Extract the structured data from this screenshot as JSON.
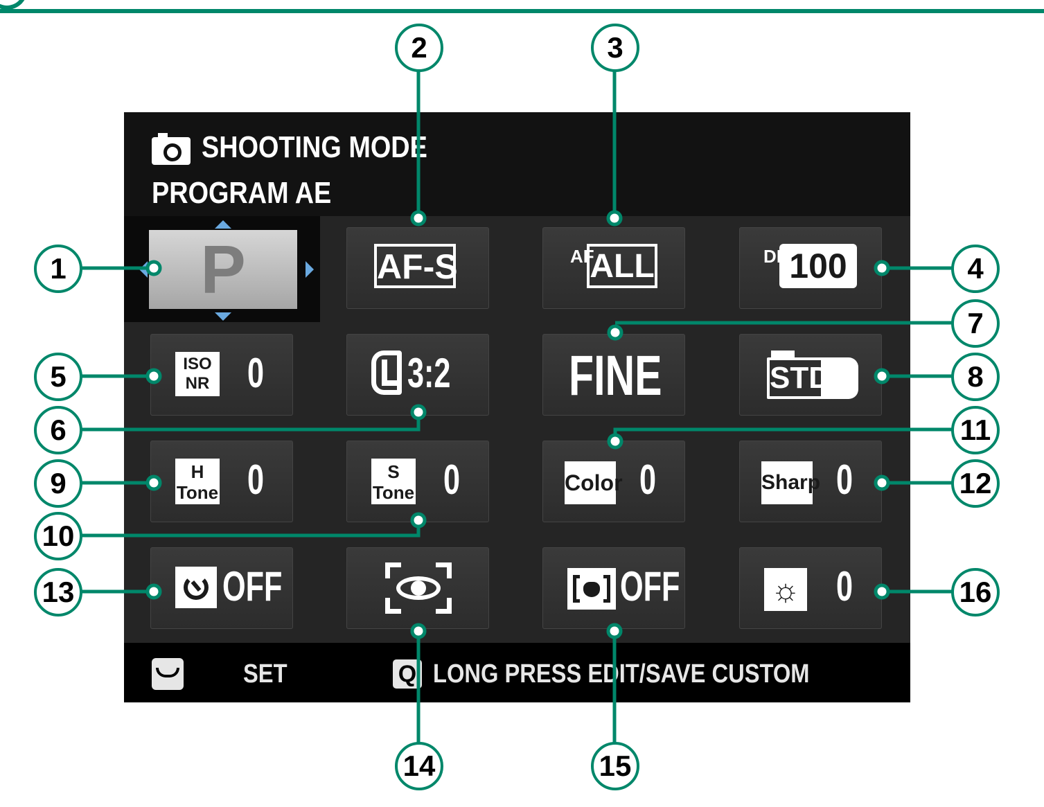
{
  "header": {
    "title": "SHOOTING MODE",
    "subtitle": "PROGRAM AE"
  },
  "tiles": {
    "mode": "P",
    "focus_mode": "AF-S",
    "af_mode_prefix": "AF",
    "af_mode": "ALL",
    "dynamic_range_prefix": "DR",
    "dynamic_range": "100",
    "iso_nr_icon": "ISO NR",
    "iso_nr_value": "0",
    "image_size": "3:2",
    "image_quality": "FINE",
    "film_simulation": "STD",
    "highlight_tone_icon": "H Tone",
    "highlight_tone_value": "0",
    "shadow_tone_icon": "S Tone",
    "shadow_tone_value": "0",
    "color_icon": "Color",
    "color_value": "0",
    "sharpness_icon": "Sharp",
    "sharpness_value": "0",
    "self_timer": "OFF",
    "face_detection": "OFF",
    "brightness_value": "0"
  },
  "footer": {
    "set_label": "SET",
    "q_key": "Q",
    "q_label": "LONG PRESS EDIT/SAVE CUSTOM"
  },
  "callouts": [
    "1",
    "2",
    "3",
    "4",
    "5",
    "6",
    "7",
    "8",
    "9",
    "10",
    "11",
    "12",
    "13",
    "14",
    "15",
    "16"
  ],
  "colors": {
    "callout_accent": "#00876a",
    "screen_bg": "#1a1a1a",
    "arrow_accent": "#6aa9e0"
  },
  "icons": [
    "camera-icon",
    "self-timer-icon",
    "eye-detection-icon",
    "pet-face-icon",
    "brightness-sun-icon",
    "setup-dial-icon"
  ]
}
